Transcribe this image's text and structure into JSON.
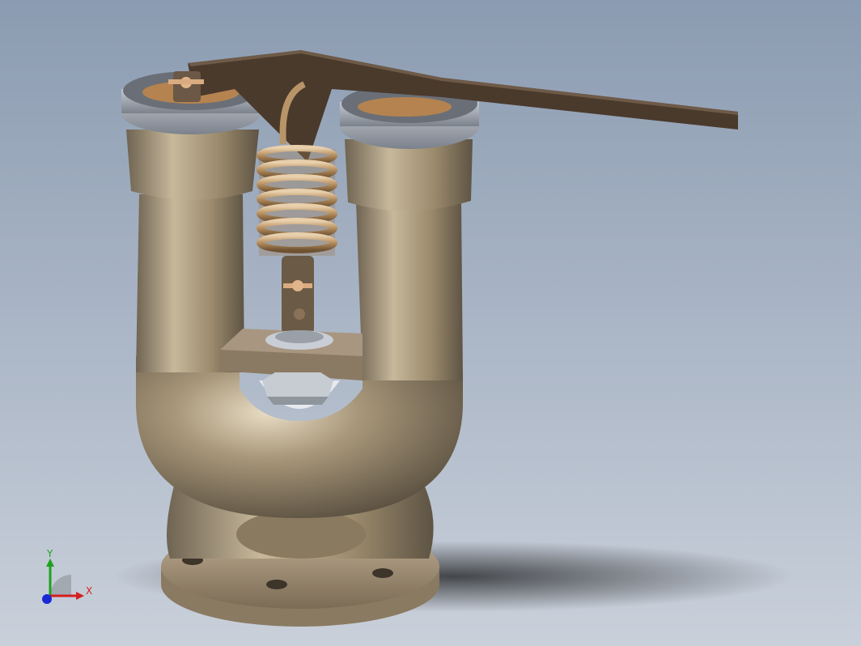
{
  "viewport": {
    "background_top": "#8b9bb1",
    "background_bottom": "#c9d0da"
  },
  "model": {
    "parts": [
      "valve-body",
      "left-bonnet",
      "right-bonnet",
      "lifting-lever",
      "tension-spring",
      "spring-bracket",
      "base-flange",
      "hex-nut"
    ],
    "colors": {
      "body": "#9b8a6c",
      "cap": "#9aa0a8",
      "lever": "#4a3a2c",
      "spring": "#b89568",
      "flange": "#a8957a"
    }
  },
  "triad": {
    "x_label": "X",
    "y_label": "Y",
    "x_color": "#d42020",
    "y_color": "#1ea21e",
    "z_color": "#1a28d4"
  }
}
